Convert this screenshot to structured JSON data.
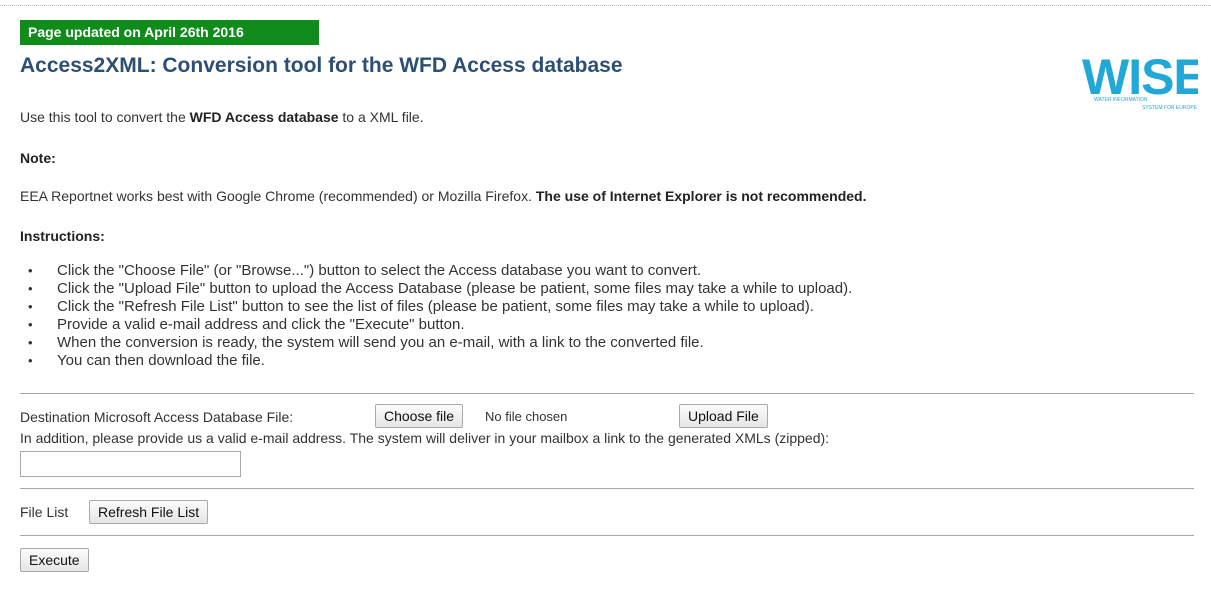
{
  "badge": "Page updated on April 26th 2016",
  "title": "Access2XML: Conversion tool for the WFD Access database",
  "logo": {
    "text": "WISE",
    "subtext1": "WATER INFORMATION",
    "subtext2": "SYSTEM FOR EUROPE",
    "color": "#21a8d6"
  },
  "intro": {
    "before": "Use this tool to convert the ",
    "bold": "WFD Access database",
    "after": " to a XML file."
  },
  "note": {
    "heading": "Note:",
    "text": "EEA Reportnet works best with Google Chrome (recommended) or Mozilla Firefox. ",
    "bold": "The use of Internet Explorer is not recommended."
  },
  "instructions": {
    "heading": "Instructions:",
    "items": [
      "Click the \"Choose File\" (or \"Browse...\") button to select the Access database you want to convert.",
      "Click the \"Upload File\" button to upload the Access Database (please be patient, some files may take a while to upload).",
      "Click the \"Refresh File List\" button to see the list of files (please be patient, some files may take a while to upload).",
      "Provide a valid e-mail address and click the \"Execute\" button.",
      "When the conversion is ready, the system will send you an e-mail, with a link to the converted file.",
      "You can then download the file."
    ]
  },
  "upload": {
    "label": "Destination Microsoft Access Database File:",
    "choose_button": "Choose file",
    "no_file": "No file chosen",
    "upload_button": "Upload File"
  },
  "email": {
    "prompt": "In addition, please provide us a valid e-mail address. The system will deliver in your mailbox a link to the generated XMLs (zipped):",
    "value": "",
    "placeholder": ""
  },
  "filelist": {
    "label": "File List",
    "refresh_button": "Refresh File List"
  },
  "execute_button": "Execute",
  "colors": {
    "badge_bg": "#118c1c",
    "title": "#2d4f73",
    "logo": "#21a8d6"
  }
}
